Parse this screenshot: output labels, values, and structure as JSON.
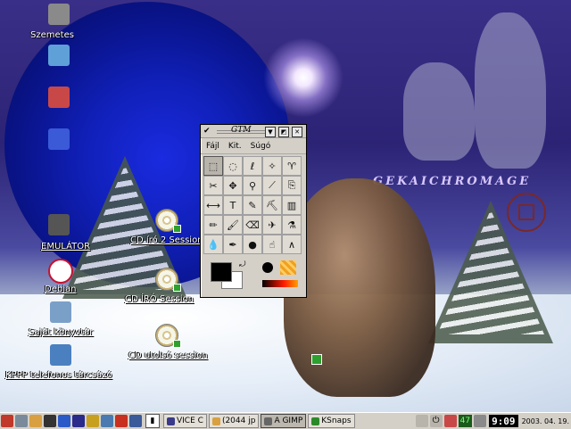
{
  "desktop": {
    "icons": [
      {
        "name": "trash-icon",
        "label": "Szemetes",
        "color": "#8a8a8a"
      },
      {
        "name": "folder-icon",
        "label": "",
        "color": "#5fa0d8"
      },
      {
        "name": "office-icon",
        "label": "",
        "color": "#c84848"
      },
      {
        "name": "control-center-icon",
        "label": "",
        "color": "#3a5ad8"
      },
      {
        "name": "terminal-icon",
        "label": "EMULÁTOR",
        "color": "#555555"
      },
      {
        "name": "debian-icon",
        "label": "Debian",
        "color": "#c8102e"
      },
      {
        "name": "home-folder-icon",
        "label": "Saját könyvtár",
        "color": "#7aa0c8"
      },
      {
        "name": "kppp-icon",
        "label": "KPPP telefonos tárcsázó",
        "color": "#4a80c0"
      }
    ],
    "cd_icons": [
      {
        "label": "CD író 2 Session"
      },
      {
        "label": "CD ÍRÓ Session"
      },
      {
        "label": "CD utolsó session"
      }
    ],
    "watermark_text": "GEKAICHROMAGE"
  },
  "gimp_toolbox": {
    "title": "GTM",
    "menus": [
      "Fájl",
      "Kit.",
      "Súgó"
    ],
    "tools": [
      {
        "name": "rect-select-tool",
        "glyph": "⬚"
      },
      {
        "name": "ellipse-select-tool",
        "glyph": "◌"
      },
      {
        "name": "free-select-tool",
        "glyph": "ℓ"
      },
      {
        "name": "fuzzy-select-tool",
        "glyph": "✧"
      },
      {
        "name": "bezier-select-tool",
        "glyph": "♈"
      },
      {
        "name": "scissors-tool",
        "glyph": "✂"
      },
      {
        "name": "move-tool",
        "glyph": "✥"
      },
      {
        "name": "magnify-tool",
        "glyph": "⚲"
      },
      {
        "name": "crop-tool",
        "glyph": "⟋"
      },
      {
        "name": "transform-tool",
        "glyph": "⎘"
      },
      {
        "name": "flip-tool",
        "glyph": "⟷"
      },
      {
        "name": "text-tool",
        "glyph": "T"
      },
      {
        "name": "color-picker-tool",
        "glyph": "✎"
      },
      {
        "name": "bucket-fill-tool",
        "glyph": "⛏"
      },
      {
        "name": "blend-tool",
        "glyph": "▥"
      },
      {
        "name": "pencil-tool",
        "glyph": "✏"
      },
      {
        "name": "paintbrush-tool",
        "glyph": "🖌"
      },
      {
        "name": "eraser-tool",
        "glyph": "⌫"
      },
      {
        "name": "airbrush-tool",
        "glyph": "✈"
      },
      {
        "name": "clone-tool",
        "glyph": "⚗"
      },
      {
        "name": "convolve-tool",
        "glyph": "💧"
      },
      {
        "name": "ink-tool",
        "glyph": "✒"
      },
      {
        "name": "dodge-burn-tool",
        "glyph": "●"
      },
      {
        "name": "smudge-tool",
        "glyph": "☝"
      },
      {
        "name": "measure-tool",
        "glyph": "∧"
      }
    ]
  },
  "taskbar": {
    "launchers": [
      {
        "name": "k-menu-icon",
        "color": "#c0392b"
      },
      {
        "name": "show-desktop-icon",
        "color": "#7a8a9a"
      },
      {
        "name": "home-icon",
        "color": "#d8a040"
      },
      {
        "name": "konsole-icon",
        "color": "#333333"
      },
      {
        "name": "help-icon",
        "color": "#2a5ac8"
      },
      {
        "name": "browser-icon",
        "color": "#2a2a8a"
      },
      {
        "name": "kmail-icon",
        "color": "#c8a020"
      },
      {
        "name": "settings-icon",
        "color": "#4a7ab0"
      },
      {
        "name": "star-icon",
        "color": "#c83020"
      },
      {
        "name": "office-launcher-icon",
        "color": "#3a5a9a"
      }
    ],
    "tasks": [
      {
        "label": "VICE C",
        "active": false,
        "color": "#3a3a8a"
      },
      {
        "label": "(2044 jp",
        "active": false,
        "color": "#d8a040"
      },
      {
        "label": "A GIMP",
        "active": true,
        "color": "#666666"
      },
      {
        "label": "KSnaps",
        "active": false,
        "color": "#2a8a2a"
      }
    ],
    "tray_text": "47",
    "clock": "9:09",
    "date": "2003. 04. 19."
  }
}
